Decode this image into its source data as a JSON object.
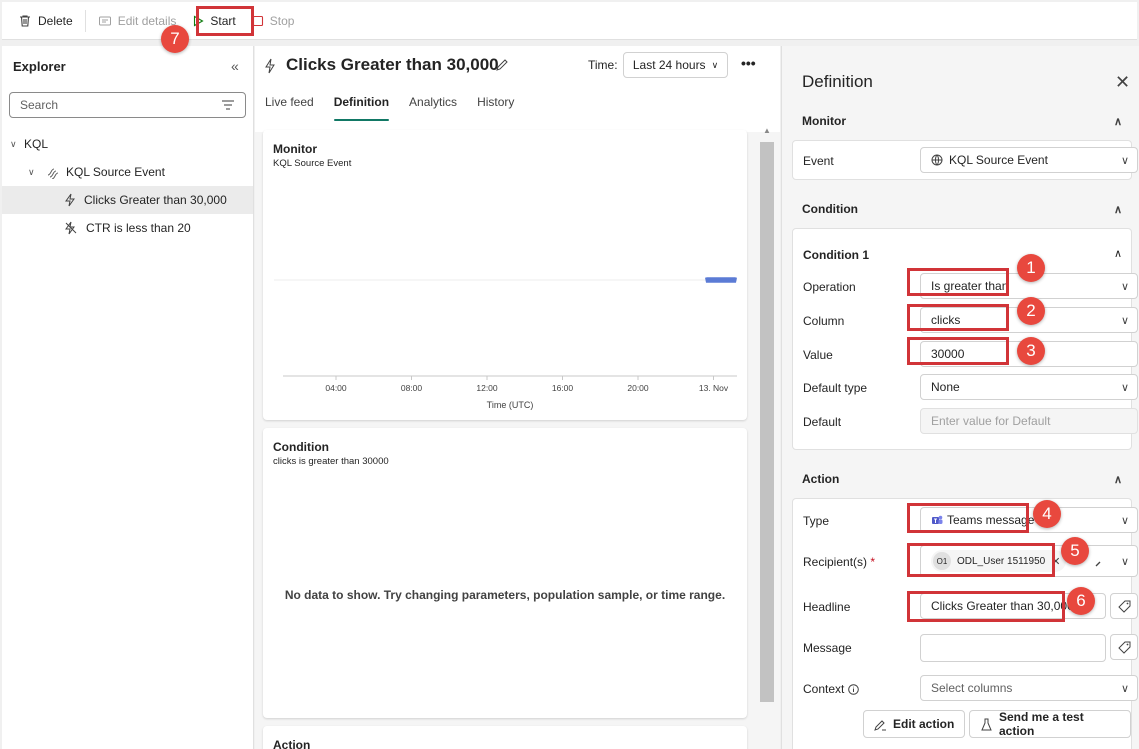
{
  "toolbar": {
    "delete_label": "Delete",
    "edit_details_label": "Edit details",
    "start_label": "Start",
    "stop_label": "Stop"
  },
  "explorer": {
    "title": "Explorer",
    "search_placeholder": "Search",
    "tree": [
      {
        "label": "KQL"
      },
      {
        "label": "KQL Source Event"
      },
      {
        "label": "Clicks Greater than 30,000"
      },
      {
        "label": "CTR is less than 20"
      }
    ]
  },
  "center": {
    "title": "Clicks Greater than 30,000",
    "time_label": "Time:",
    "time_value": "Last 24 hours",
    "more": "•••",
    "tabs": [
      "Live feed",
      "Definition",
      "Analytics",
      "History"
    ],
    "active_tab": "Definition",
    "monitor_card": {
      "title": "Monitor",
      "subtitle": "KQL Source Event"
    },
    "condition_card": {
      "title": "Condition",
      "subtitle": "clicks is greater than 30000",
      "empty_message": "No data to show. Try changing parameters, population sample, or time range."
    },
    "action_card": {
      "title": "Action"
    }
  },
  "chart_data": {
    "type": "line",
    "x_ticks": [
      "04:00",
      "08:00",
      "12:00",
      "16:00",
      "20:00",
      "13. Nov"
    ],
    "xlabel": "Time (UTC)",
    "series_color": "#5b7bd5"
  },
  "definition": {
    "title": "Definition",
    "monitor": {
      "heading": "Monitor",
      "event_label": "Event",
      "event_value": "KQL Source Event"
    },
    "condition": {
      "heading": "Condition",
      "sub_heading": "Condition 1",
      "operation_label": "Operation",
      "operation_value": "Is greater than",
      "column_label": "Column",
      "column_value": "clicks",
      "value_label": "Value",
      "value_value": "30000",
      "default_type_label": "Default type",
      "default_type_value": "None",
      "default_label": "Default",
      "default_placeholder": "Enter value for Default"
    },
    "action": {
      "heading": "Action",
      "type_label": "Type",
      "type_value": "Teams message",
      "recipients_label": "Recipient(s)",
      "required_marker": "*",
      "recipient_initials": "O1",
      "recipient_name": "ODL_User 1511950",
      "headline_label": "Headline",
      "headline_value": "Clicks Greater than 30,000",
      "message_label": "Message",
      "context_label": "Context",
      "context_placeholder": "Select columns",
      "edit_action_label": "Edit action",
      "send_test_label": "Send me a test action"
    }
  },
  "annotations": [
    "1",
    "2",
    "3",
    "4",
    "5",
    "6",
    "7"
  ],
  "colors": {
    "highlight": "#d13438",
    "badge": "#e8483e",
    "tab_accent": "#117865",
    "start_icon": "#107c10",
    "stop_icon": "#d13438"
  }
}
